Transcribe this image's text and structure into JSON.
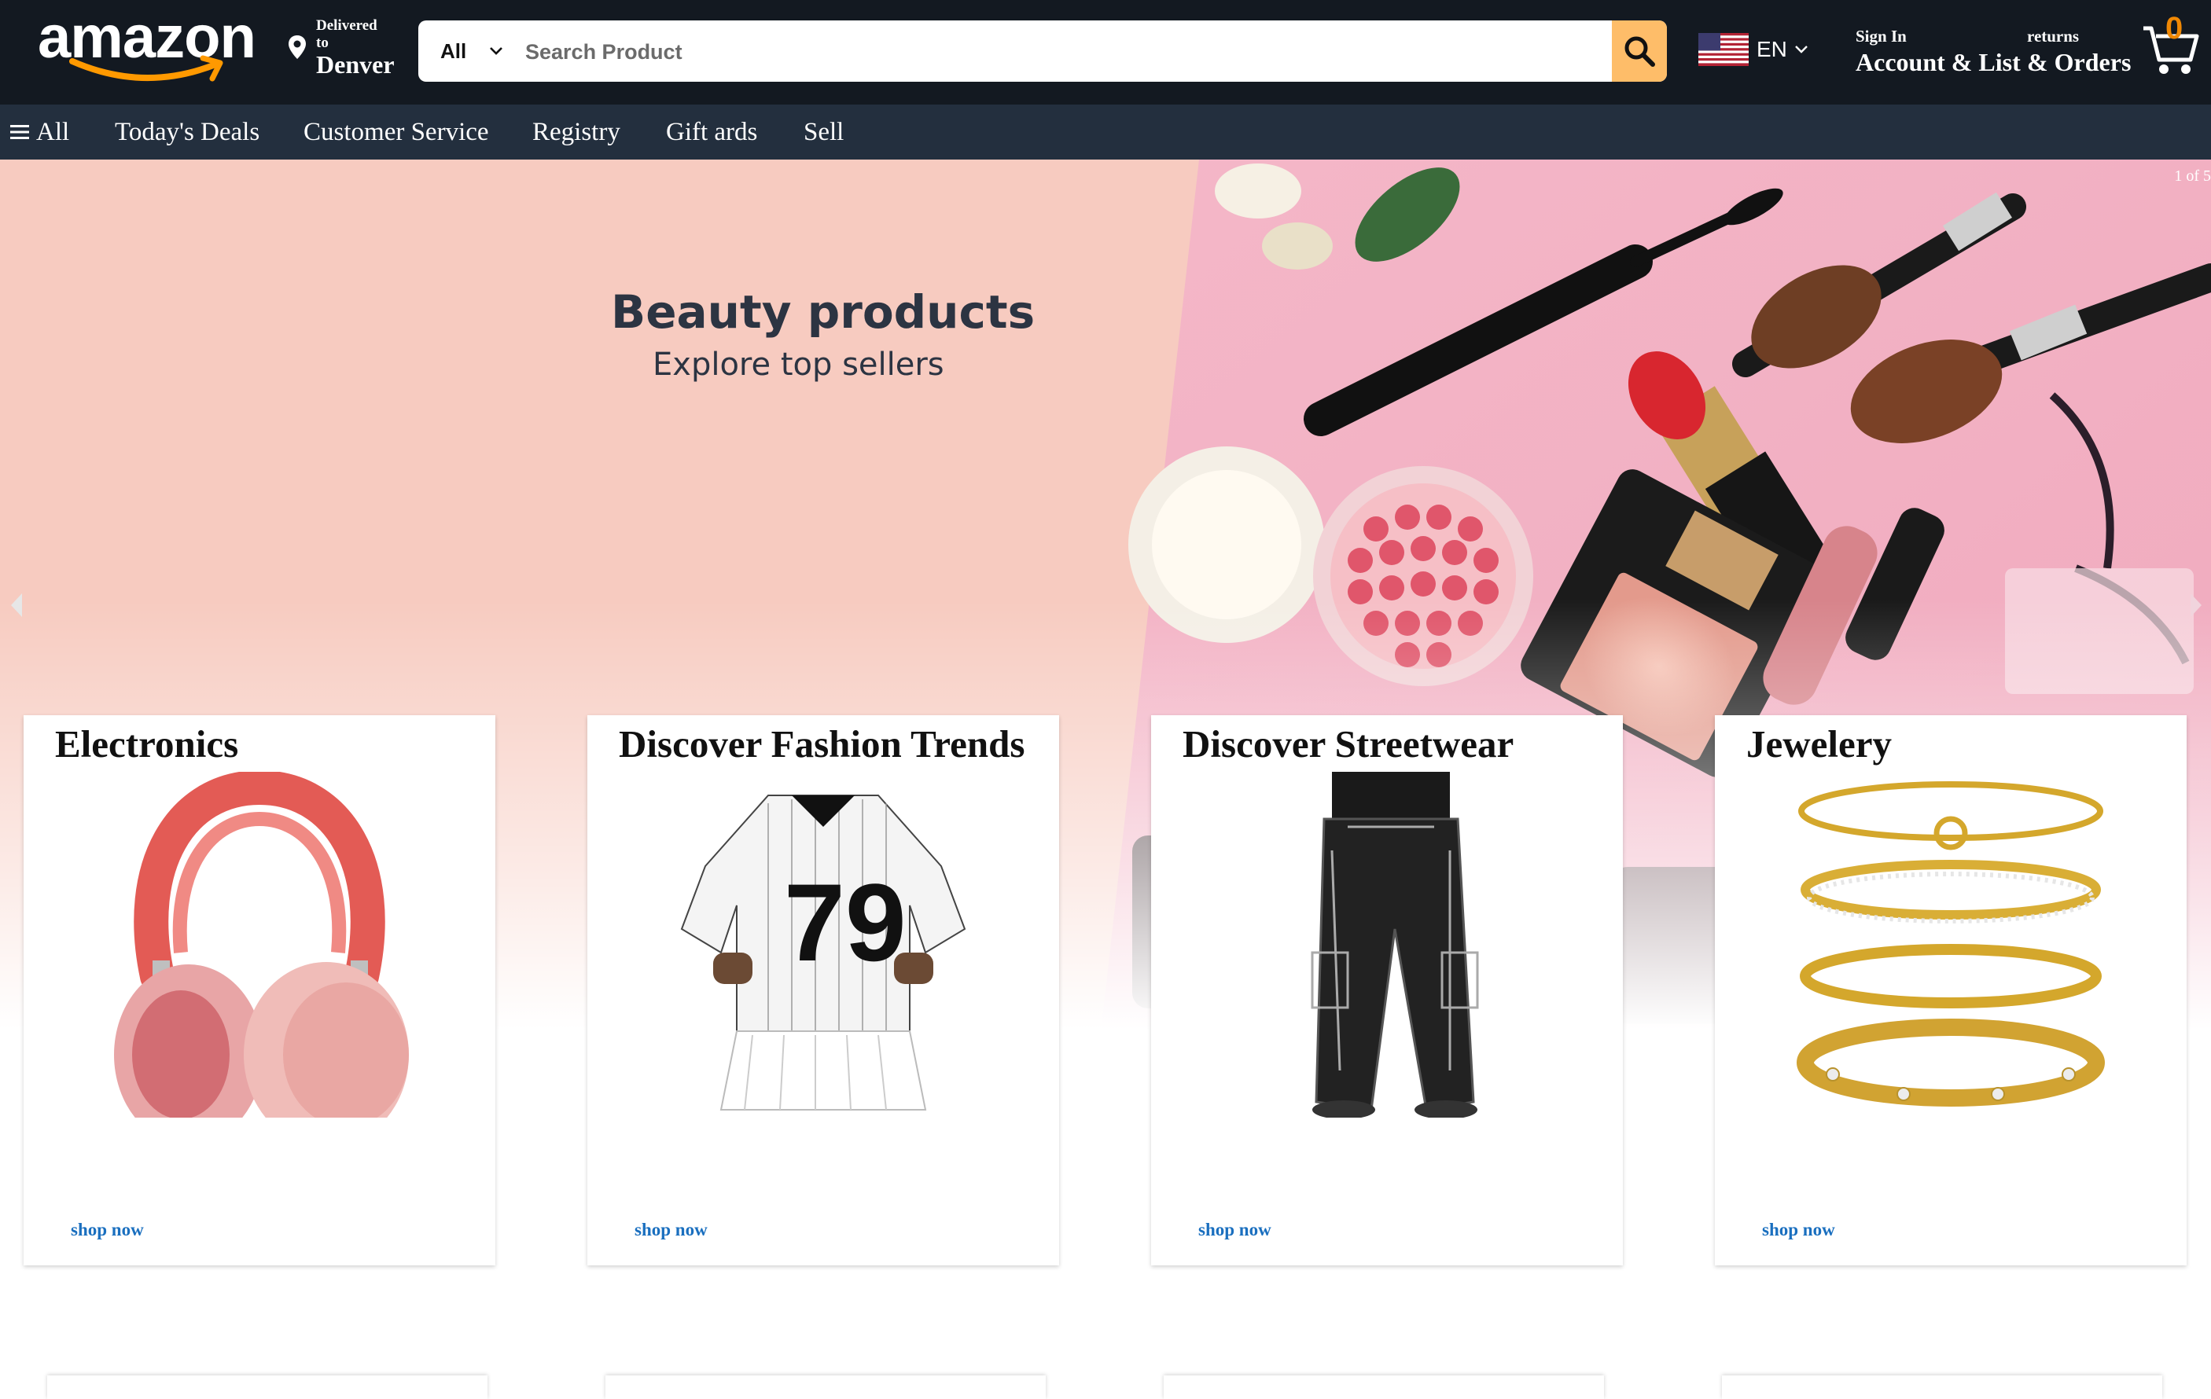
{
  "header": {
    "logo_text": "amazon",
    "deliver_line1": "Delivered",
    "deliver_line2": "to",
    "deliver_city": "Denver",
    "search_category": "All",
    "search_placeholder": "Search Product",
    "language": "EN",
    "signin_small": "Sign In",
    "signin_big": "Account & List",
    "returns_small": "returns",
    "returns_big": "& Orders",
    "cart_count": "0"
  },
  "nav": {
    "all_label": "All",
    "items": [
      "Today's Deals",
      "Customer Service",
      "Registry",
      "Gift ards",
      "Sell"
    ]
  },
  "hero": {
    "title": "Beauty products",
    "subtitle": "Explore top sellers",
    "counter": "1 of 5"
  },
  "cards": [
    {
      "title": "Electronics",
      "link": "shop now"
    },
    {
      "title": "Discover Fashion Trends",
      "link": "shop now"
    },
    {
      "title": "Discover Streetwear",
      "link": "shop now"
    },
    {
      "title": "Jewelery",
      "link": "shop now"
    }
  ],
  "colors": {
    "header_bg": "#131921",
    "nav_bg": "#232f3e",
    "search_button": "#febd69",
    "link": "#1a6fbf",
    "hero_bg": "#f7cbc0"
  }
}
